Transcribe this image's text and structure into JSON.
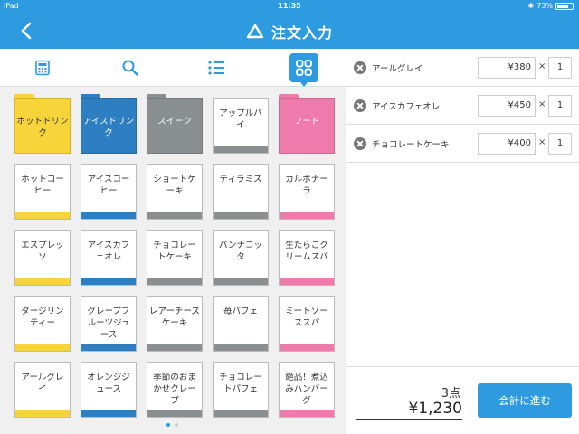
{
  "status": {
    "device": "iPad",
    "time": "11:35",
    "battery": "73%",
    "battery_level": 0.73
  },
  "nav": {
    "title": "注文入力"
  },
  "toolbar": {
    "icons": [
      "calculator-icon",
      "search-icon",
      "list-icon",
      "grid-icon"
    ],
    "active": "grid-icon"
  },
  "colors": {
    "accent": "#2e9be0",
    "yellow": "#f7d43a",
    "blue": "#2d7fc1",
    "gray": "#8a9091",
    "pink": "#ef7bac"
  },
  "categories": [
    {
      "label": "ホットドリンク",
      "color": "yellow"
    },
    {
      "label": "アイスドリンク",
      "color": "blue"
    },
    {
      "label": "スイーツ",
      "color": "gray"
    },
    {
      "label": "アップルパイ",
      "color": "gray",
      "type": "item"
    },
    {
      "label": "フード",
      "color": "pink"
    }
  ],
  "items": [
    {
      "label": "ホットコーヒー",
      "color": "yellow"
    },
    {
      "label": "アイスコーヒー",
      "color": "blue"
    },
    {
      "label": "ショートケーキ",
      "color": "gray"
    },
    {
      "label": "ティラミス",
      "color": "gray"
    },
    {
      "label": "カルボナーラ",
      "color": "pink"
    },
    {
      "label": "エスプレッソ",
      "color": "yellow"
    },
    {
      "label": "アイスカフェオレ",
      "color": "blue"
    },
    {
      "label": "チョコレートケーキ",
      "color": "gray"
    },
    {
      "label": "パンナコッタ",
      "color": "gray"
    },
    {
      "label": "生たらこクリームスパ",
      "color": "pink"
    },
    {
      "label": "ダージリンティー",
      "color": "yellow"
    },
    {
      "label": "グレープフルーツジュース",
      "color": "blue"
    },
    {
      "label": "レアーチーズケーキ",
      "color": "gray"
    },
    {
      "label": "苺パフェ",
      "color": "gray"
    },
    {
      "label": "ミートソーススパ",
      "color": "pink"
    },
    {
      "label": "アールグレイ",
      "color": "yellow"
    },
    {
      "label": "オレンジジュース",
      "color": "blue"
    },
    {
      "label": "季節のおまかせクレープ",
      "color": "gray"
    },
    {
      "label": "チョコレートパフェ",
      "color": "gray"
    },
    {
      "label": "絶品！煮込みハンバーグ",
      "color": "pink"
    }
  ],
  "order": [
    {
      "name": "アールグレイ",
      "price": "¥380",
      "times": "×",
      "qty": "1"
    },
    {
      "name": "アイスカフェオレ",
      "price": "¥450",
      "times": "×",
      "qty": "1"
    },
    {
      "name": "チョコレートケーキ",
      "price": "¥400",
      "times": "×",
      "qty": "1"
    }
  ],
  "summary": {
    "count": "3点",
    "total": "¥1,230",
    "checkout_label": "会計に進む"
  },
  "pager": {
    "pages": 2,
    "current": 1
  }
}
